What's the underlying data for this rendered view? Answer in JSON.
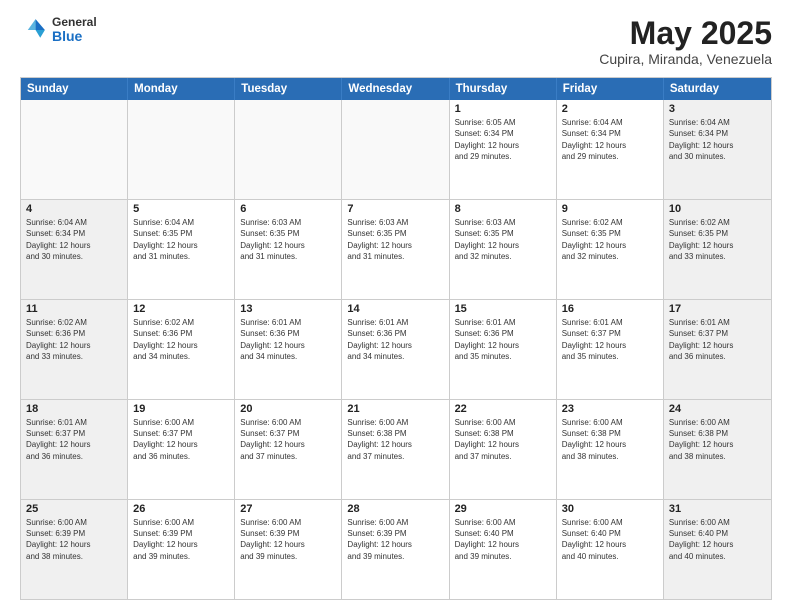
{
  "header": {
    "logo_general": "General",
    "logo_blue": "Blue",
    "title": "May 2025",
    "location": "Cupira, Miranda, Venezuela"
  },
  "calendar": {
    "days_of_week": [
      "Sunday",
      "Monday",
      "Tuesday",
      "Wednesday",
      "Thursday",
      "Friday",
      "Saturday"
    ],
    "weeks": [
      [
        {
          "day": "",
          "info": "",
          "empty": true
        },
        {
          "day": "",
          "info": "",
          "empty": true
        },
        {
          "day": "",
          "info": "",
          "empty": true
        },
        {
          "day": "",
          "info": "",
          "empty": true
        },
        {
          "day": "1",
          "info": "Sunrise: 6:05 AM\nSunset: 6:34 PM\nDaylight: 12 hours\nand 29 minutes."
        },
        {
          "day": "2",
          "info": "Sunrise: 6:04 AM\nSunset: 6:34 PM\nDaylight: 12 hours\nand 29 minutes."
        },
        {
          "day": "3",
          "info": "Sunrise: 6:04 AM\nSunset: 6:34 PM\nDaylight: 12 hours\nand 30 minutes."
        }
      ],
      [
        {
          "day": "4",
          "info": "Sunrise: 6:04 AM\nSunset: 6:34 PM\nDaylight: 12 hours\nand 30 minutes."
        },
        {
          "day": "5",
          "info": "Sunrise: 6:04 AM\nSunset: 6:35 PM\nDaylight: 12 hours\nand 31 minutes."
        },
        {
          "day": "6",
          "info": "Sunrise: 6:03 AM\nSunset: 6:35 PM\nDaylight: 12 hours\nand 31 minutes."
        },
        {
          "day": "7",
          "info": "Sunrise: 6:03 AM\nSunset: 6:35 PM\nDaylight: 12 hours\nand 31 minutes."
        },
        {
          "day": "8",
          "info": "Sunrise: 6:03 AM\nSunset: 6:35 PM\nDaylight: 12 hours\nand 32 minutes."
        },
        {
          "day": "9",
          "info": "Sunrise: 6:02 AM\nSunset: 6:35 PM\nDaylight: 12 hours\nand 32 minutes."
        },
        {
          "day": "10",
          "info": "Sunrise: 6:02 AM\nSunset: 6:35 PM\nDaylight: 12 hours\nand 33 minutes."
        }
      ],
      [
        {
          "day": "11",
          "info": "Sunrise: 6:02 AM\nSunset: 6:36 PM\nDaylight: 12 hours\nand 33 minutes."
        },
        {
          "day": "12",
          "info": "Sunrise: 6:02 AM\nSunset: 6:36 PM\nDaylight: 12 hours\nand 34 minutes."
        },
        {
          "day": "13",
          "info": "Sunrise: 6:01 AM\nSunset: 6:36 PM\nDaylight: 12 hours\nand 34 minutes."
        },
        {
          "day": "14",
          "info": "Sunrise: 6:01 AM\nSunset: 6:36 PM\nDaylight: 12 hours\nand 34 minutes."
        },
        {
          "day": "15",
          "info": "Sunrise: 6:01 AM\nSunset: 6:36 PM\nDaylight: 12 hours\nand 35 minutes."
        },
        {
          "day": "16",
          "info": "Sunrise: 6:01 AM\nSunset: 6:37 PM\nDaylight: 12 hours\nand 35 minutes."
        },
        {
          "day": "17",
          "info": "Sunrise: 6:01 AM\nSunset: 6:37 PM\nDaylight: 12 hours\nand 36 minutes."
        }
      ],
      [
        {
          "day": "18",
          "info": "Sunrise: 6:01 AM\nSunset: 6:37 PM\nDaylight: 12 hours\nand 36 minutes."
        },
        {
          "day": "19",
          "info": "Sunrise: 6:00 AM\nSunset: 6:37 PM\nDaylight: 12 hours\nand 36 minutes."
        },
        {
          "day": "20",
          "info": "Sunrise: 6:00 AM\nSunset: 6:37 PM\nDaylight: 12 hours\nand 37 minutes."
        },
        {
          "day": "21",
          "info": "Sunrise: 6:00 AM\nSunset: 6:38 PM\nDaylight: 12 hours\nand 37 minutes."
        },
        {
          "day": "22",
          "info": "Sunrise: 6:00 AM\nSunset: 6:38 PM\nDaylight: 12 hours\nand 37 minutes."
        },
        {
          "day": "23",
          "info": "Sunrise: 6:00 AM\nSunset: 6:38 PM\nDaylight: 12 hours\nand 38 minutes."
        },
        {
          "day": "24",
          "info": "Sunrise: 6:00 AM\nSunset: 6:38 PM\nDaylight: 12 hours\nand 38 minutes."
        }
      ],
      [
        {
          "day": "25",
          "info": "Sunrise: 6:00 AM\nSunset: 6:39 PM\nDaylight: 12 hours\nand 38 minutes."
        },
        {
          "day": "26",
          "info": "Sunrise: 6:00 AM\nSunset: 6:39 PM\nDaylight: 12 hours\nand 39 minutes."
        },
        {
          "day": "27",
          "info": "Sunrise: 6:00 AM\nSunset: 6:39 PM\nDaylight: 12 hours\nand 39 minutes."
        },
        {
          "day": "28",
          "info": "Sunrise: 6:00 AM\nSunset: 6:39 PM\nDaylight: 12 hours\nand 39 minutes."
        },
        {
          "day": "29",
          "info": "Sunrise: 6:00 AM\nSunset: 6:40 PM\nDaylight: 12 hours\nand 39 minutes."
        },
        {
          "day": "30",
          "info": "Sunrise: 6:00 AM\nSunset: 6:40 PM\nDaylight: 12 hours\nand 40 minutes."
        },
        {
          "day": "31",
          "info": "Sunrise: 6:00 AM\nSunset: 6:40 PM\nDaylight: 12 hours\nand 40 minutes."
        }
      ]
    ]
  }
}
